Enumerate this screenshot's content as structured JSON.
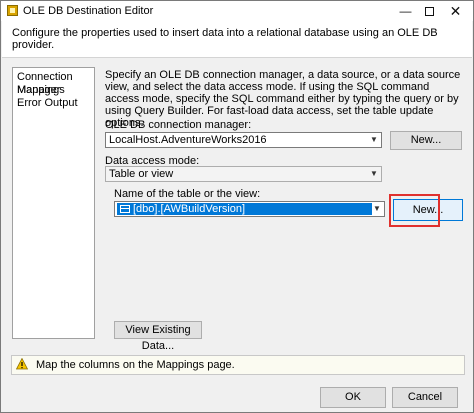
{
  "window": {
    "title": "OLE DB Destination Editor"
  },
  "header": {
    "description": "Configure the properties used to insert data into a relational database using an OLE DB provider."
  },
  "nav": {
    "items": [
      "Connection Manager",
      "Mappings",
      "Error Output"
    ]
  },
  "main": {
    "intro": "Specify an OLE DB connection manager, a data source, or a data source view, and select the data access mode. If using the SQL command access mode, specify the SQL command either by typing the query or by using Query Builder. For fast-load data access, set the table update options.",
    "connection_label": "OLE DB connection manager:",
    "connection_value": "LocalHost.AdventureWorks2016",
    "connection_new": "New...",
    "access_label": "Data access mode:",
    "access_value": "Table or view",
    "table_label": "Name of the table or the view:",
    "table_value": "[dbo].[AWBuildVersion]",
    "table_new": "New...",
    "view_button": "View Existing Data..."
  },
  "info": {
    "message": "Map the columns on the Mappings page."
  },
  "footer": {
    "ok": "OK",
    "cancel": "Cancel"
  },
  "colors": {
    "highlight": "#e0312e",
    "selection": "#0078d7"
  },
  "icons": [
    "app-icon",
    "minimize-icon",
    "maximize-icon",
    "close-icon",
    "dropdown-arrow-icon",
    "table-icon",
    "warning-icon"
  ]
}
